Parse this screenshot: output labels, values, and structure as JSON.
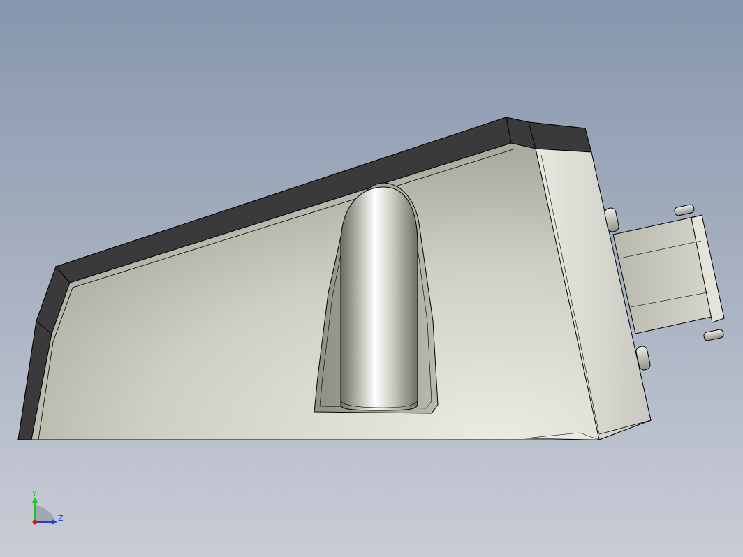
{
  "viewport": {
    "background_top": "#8796ad",
    "background_bottom": "#c9ccd6"
  },
  "model": {
    "body_color": "#cfcfc3",
    "body_highlight": "#ebebdf",
    "edge_trim_color": "#3a3a3a",
    "outline_color": "#000000"
  },
  "triad": {
    "y_label": "Y",
    "z_label": "Z",
    "y_color": "#22c322",
    "z_color": "#1f3fd8",
    "x_color": "#d01a1a"
  }
}
